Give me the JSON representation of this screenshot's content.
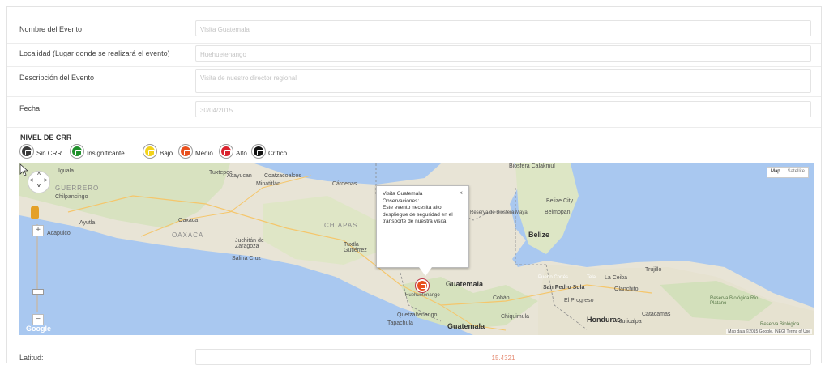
{
  "form": {
    "nombre": {
      "label": "Nombre del Evento",
      "value": "Visita Guatemala"
    },
    "localidad": {
      "label": "Localidad (Lugar donde se realizará el evento)",
      "value": "Huehuetenango"
    },
    "descripcion": {
      "label": "Descripción del Evento",
      "value": "Visita de nuestro director regional"
    },
    "fecha": {
      "label": "Fecha",
      "value": "30/04/2015"
    },
    "latitud": {
      "label": "Latitud:",
      "value": "15.4321"
    }
  },
  "crr": {
    "title": "NIVEL DE CRR",
    "levels": [
      {
        "label": "Sin CRR",
        "color": "#3a3a3a"
      },
      {
        "label": "Insignificante",
        "color": "#1f8f2b"
      },
      {
        "label": "Bajo",
        "color": "#f2d21b"
      },
      {
        "label": "Medio",
        "color": "#e8501e"
      },
      {
        "label": "Alto",
        "color": "#d9232e"
      },
      {
        "label": "Crítico",
        "color": "#111111"
      }
    ]
  },
  "map": {
    "map_type": [
      "Map",
      "Satellite"
    ],
    "google_logo": "Google",
    "attribution": "Map data ©2015 Google, INEGI   Terms of Use",
    "labels": {
      "guerrero": "GUERRERO",
      "chilpancingo": "Chilpancingo",
      "iguala": "Iguala",
      "acapulco": "Acapulco",
      "ayutla": "Ayutla",
      "oaxaca_state": "OAXACA",
      "oaxaca_city": "Oaxaca",
      "chiapas": "CHIAPAS",
      "tuxtla": "Tuxtla Gutiérrez",
      "coatzacoalcos": "Coatzacoalcos",
      "acayucan": "Acayucan",
      "minatitlan": "Minatitlán",
      "cardenas": "Cárdenas",
      "tuxtepec": "Tuxtepec",
      "juchitan": "Juchitán de Zaragoza",
      "salina_cruz": "Salina Cruz",
      "guatemala": "Guatemala",
      "guatemala_city": "Guatemala",
      "belize": "Belize",
      "belize_city": "Belize City",
      "belmopan": "Belmopan",
      "honduras": "Honduras",
      "san_pedro_sula": "San Pedro Sula",
      "la_ceiba": "La Ceiba",
      "el_progreso": "El Progreso",
      "tela": "Tela",
      "puerto_cortes": "Puerto Cortés",
      "trujillo": "Trujillo",
      "olanchito": "Olanchito",
      "catacamas": "Catacamas",
      "juticalpa": "Juticalpa",
      "quetzaltenango": "Quetzaltenango",
      "tapachula": "Tapachula",
      "coban": "Cobán",
      "huehuetenango": "Huehuetenango",
      "calakmul": "Biosfera Calakmul",
      "maya": "Reserva de Biosfera Maya",
      "rio_platano": "Reserva Biológica Río Plátano",
      "reserva_bio": "Reserva Biológica",
      "chiquimula": "Chiquimula"
    },
    "infowindow": {
      "title": "Visita Guatemala",
      "obs_label": "Observaciones:",
      "obs_text": "Este evento necesita alto despliegue de seguridad en el transporte de nuestra visita",
      "close": "×"
    }
  }
}
